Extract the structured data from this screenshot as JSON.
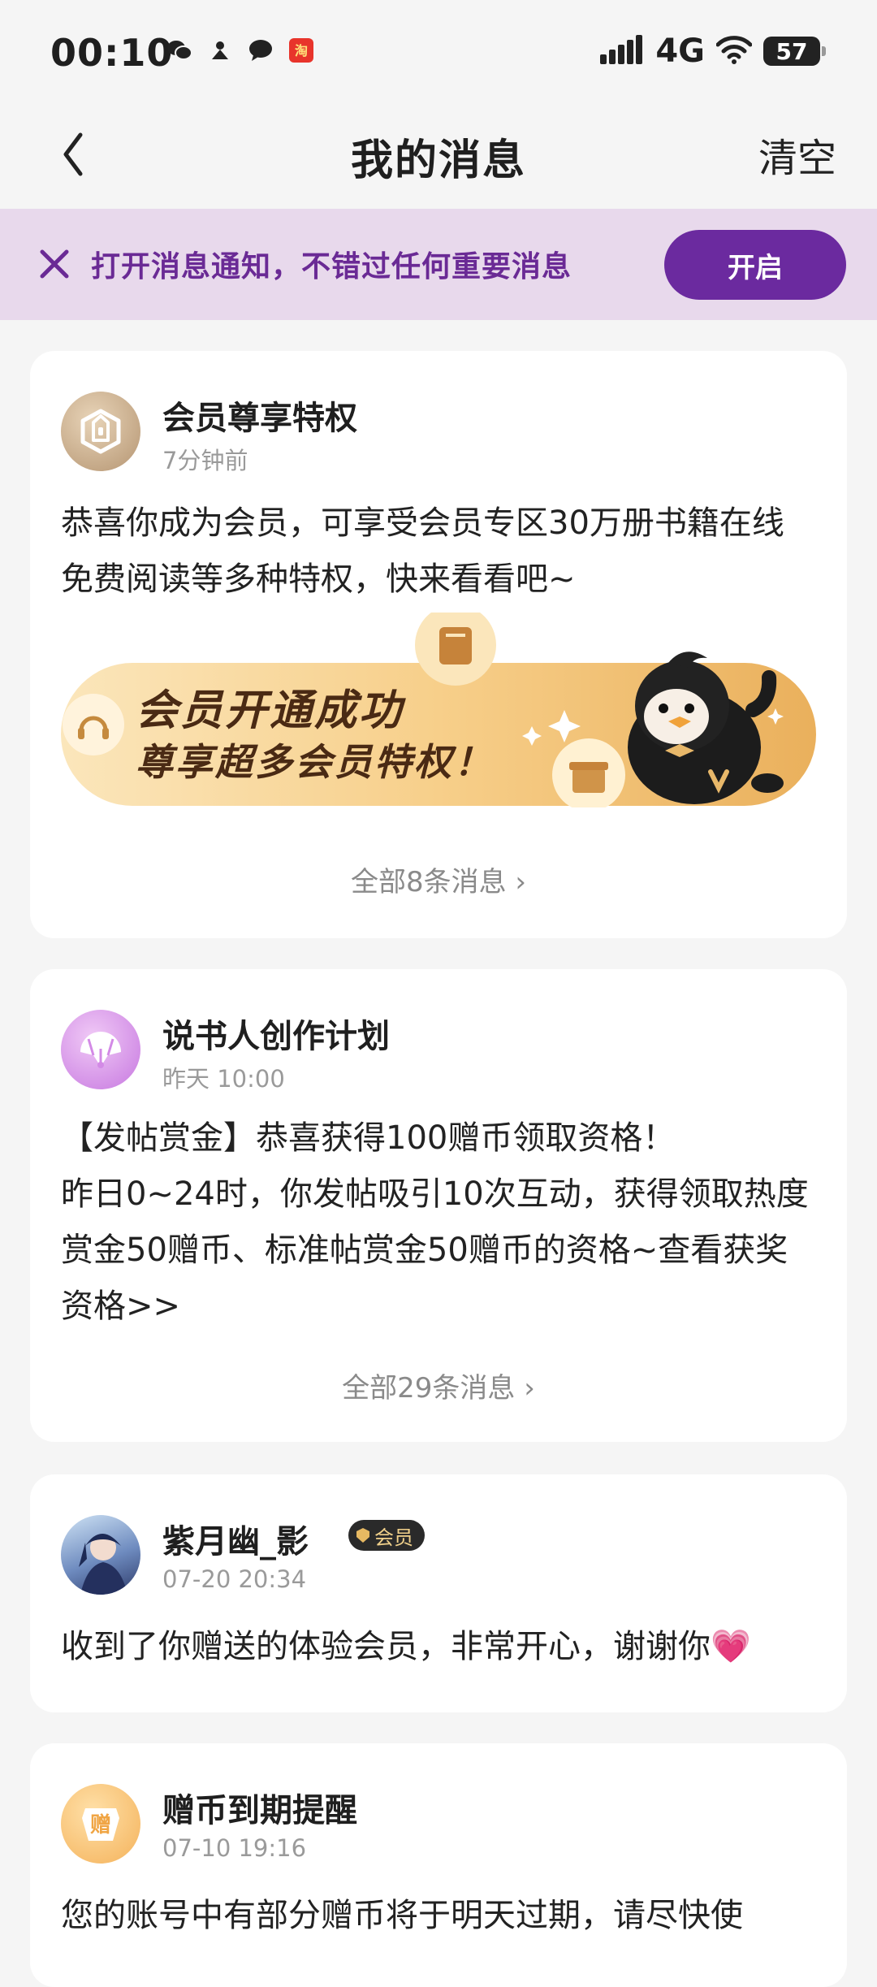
{
  "status_bar": {
    "time": "00:10",
    "network": "4G",
    "battery": "57",
    "icons": [
      "wechat-icon",
      "app-icon",
      "message-icon",
      "taobao-icon",
      "signal-icon",
      "wifi-icon",
      "battery-icon"
    ]
  },
  "header": {
    "title": "我的消息",
    "clear_label": "清空",
    "back_icon": "chevron-left-icon"
  },
  "notification_banner": {
    "text": "打开消息通知，不错过任何重要消息",
    "button_label": "开启",
    "accent_color": "#6b2a9f",
    "background_color": "#e8d9ec"
  },
  "cards": [
    {
      "title": "会员尊享特权",
      "time": "7分钟前",
      "body": "恭喜你成为会员，可享受会员专区30万册书籍在线免费阅读等多种特权，快来看看吧~",
      "promo_line1": "会员开通成功",
      "promo_line2": "尊享超多会员特权！",
      "more_label": "全部8条消息 ›"
    },
    {
      "title": "说书人创作计划",
      "time": "昨天 10:00",
      "body": "【发帖赏金】恭喜获得100赠币领取资格！\n昨日0~24时，你发帖吸引10次互动，获得领取热度赏金50赠币、标准帖赏金50赠币的资格~查看获奖资格>>",
      "more_label": "全部29条消息 ›"
    },
    {
      "title": "紫月幽_影",
      "badge": "会员",
      "time": "07-20 20:34",
      "body": "收到了你赠送的体验会员，非常开心，谢谢你💗"
    },
    {
      "title": "赠币到期提醒",
      "avatar_text": "赠",
      "time": "07-10 19:16",
      "body": "您的账号中有部分赠币将于明天过期，请尽快使"
    }
  ]
}
